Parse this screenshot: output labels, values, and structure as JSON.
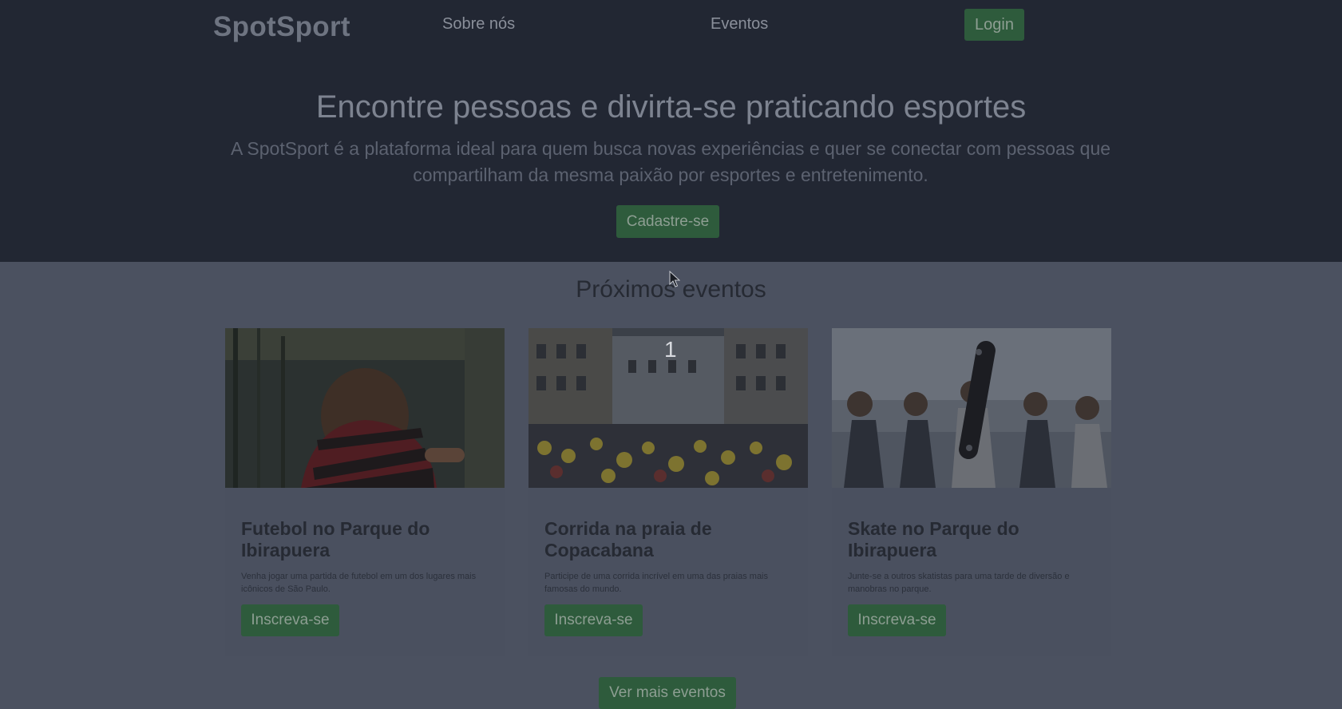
{
  "header": {
    "logo": "SpotSport",
    "nav": [
      "Sobre nós",
      "Eventos"
    ],
    "login_label": "Login"
  },
  "hero": {
    "title": "Encontre pessoas e divirta-se praticando esportes",
    "subtitle": "A SpotSport é a plataforma ideal para quem busca novas experiências e quer se conectar com pessoas que compartilham da mesma paixão por esportes e entretenimento.",
    "cta_label": "Cadastre-se"
  },
  "events": {
    "title": "Próximos eventos",
    "more_label": "Ver mais eventos",
    "cards": [
      {
        "title": "Futebol no Parque do Ibirapuera",
        "description": "Venha jogar uma partida de futebol em um dos lugares mais icônicos de São Paulo.",
        "button": "Inscreva-se"
      },
      {
        "title": "Corrida na praia de Copacabana",
        "description": "Participe de uma corrida incrível em uma das praias mais famosas do mundo.",
        "button": "Inscreva-se"
      },
      {
        "title": "Skate no Parque do Ibirapuera",
        "description": "Junte-se a outros skatistas para uma tarde de diversão e manobras no parque.",
        "button": "Inscreva-se"
      }
    ]
  },
  "overlay": {
    "slide_number": "1"
  },
  "colors": {
    "header_bg": "#222733",
    "page_bg": "#4b5160",
    "button_green": "#2e5b3c"
  },
  "icons": [
    "mouse-cursor-icon"
  ]
}
